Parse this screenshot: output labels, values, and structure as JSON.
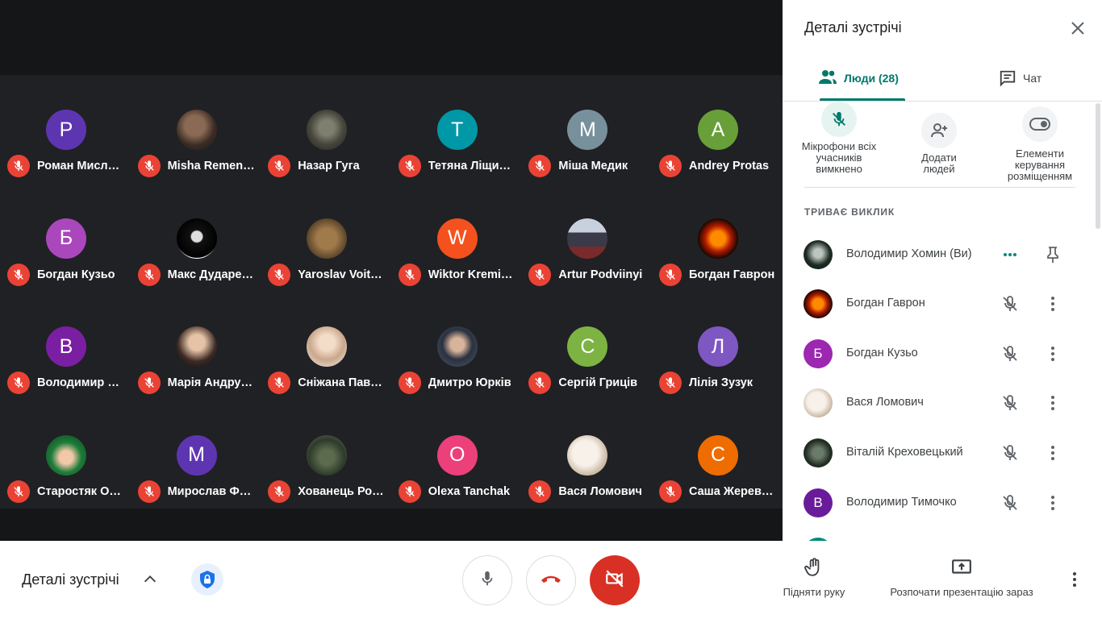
{
  "panel": {
    "title": "Деталі зустрічі",
    "tab_people": "Люди (28)",
    "tab_chat": "Чат",
    "action_mute_all": "Мікрофони всіх учасників вимкнено",
    "action_add_people": "Додати людей",
    "action_host_controls": "Елементи керування розміщенням",
    "section_label": "ТРИВАЄ ВИКЛИК",
    "people": [
      {
        "name": "Володимир Хомин (Ви)"
      },
      {
        "name": "Богдан Гаврон"
      },
      {
        "name": "Богдан Кузьо",
        "initial": "Б",
        "color": "#9c27b0"
      },
      {
        "name": "Вася Ломович"
      },
      {
        "name": "Віталій Креховецький"
      },
      {
        "name": "Володимир Тимочко",
        "initial": "В",
        "color": "#6a1b9a"
      }
    ]
  },
  "grid": {
    "tiles": [
      {
        "name": "Роман Мисл…",
        "initial": "Р",
        "color": "#5e35b1"
      },
      {
        "name": "Misha Remen…"
      },
      {
        "name": "Назар Гуга"
      },
      {
        "name": "Тетяна Ліщи…",
        "initial": "Т",
        "color": "#0097a7"
      },
      {
        "name": "Міша Медик",
        "initial": "М",
        "color": "#78909c"
      },
      {
        "name": "Andrey Protas",
        "initial": "A",
        "color": "#689f38"
      },
      {
        "name": "Богдан Кузьо",
        "initial": "Б",
        "color": "#ab47bc"
      },
      {
        "name": "Макс Дударе…"
      },
      {
        "name": "Yaroslav Voit…"
      },
      {
        "name": "Wiktor Kremi…",
        "initial": "W",
        "color": "#f4511e"
      },
      {
        "name": "Artur Podviinyi"
      },
      {
        "name": "Богдан Гаврон"
      },
      {
        "name": "Володимир Т…",
        "initial": "В",
        "color": "#7b1fa2"
      },
      {
        "name": "Марія Андру…"
      },
      {
        "name": "Сніжана Пав…"
      },
      {
        "name": "Дмитро Юрків"
      },
      {
        "name": "Сергій Гриців",
        "initial": "С",
        "color": "#7cb342"
      },
      {
        "name": "Лілія Зузук",
        "initial": "Л",
        "color": "#7e57c2"
      },
      {
        "name": "Старостяк О…"
      },
      {
        "name": "Мирослав Ф…",
        "initial": "М",
        "color": "#5e35b1"
      },
      {
        "name": "Хованець Ро…"
      },
      {
        "name": "Olexa Tanchak",
        "initial": "O",
        "color": "#ec407a"
      },
      {
        "name": "Вася Ломович"
      },
      {
        "name": "Саша Жерев…",
        "initial": "С",
        "color": "#ef6c00"
      }
    ]
  },
  "bottom_bar": {
    "meeting_details": "Деталі зустрічі",
    "raise_hand": "Підняти руку",
    "present_now": "Розпочати презентацію зараз"
  },
  "colors": {
    "accent": "#00796b",
    "mic_off": "#ea4335",
    "stage": "#202124",
    "camera_off": "#d93025"
  },
  "icons": [
    "close-icon",
    "people-icon",
    "chat-icon",
    "mic-off-icon",
    "add-person-icon",
    "toggle-icon",
    "more-dots-icon",
    "pin-icon",
    "chevron-up-icon",
    "shield-lock-icon",
    "mic-icon",
    "hang-up-icon",
    "camera-off-icon",
    "hand-icon",
    "present-icon",
    "more-vert-icon"
  ]
}
